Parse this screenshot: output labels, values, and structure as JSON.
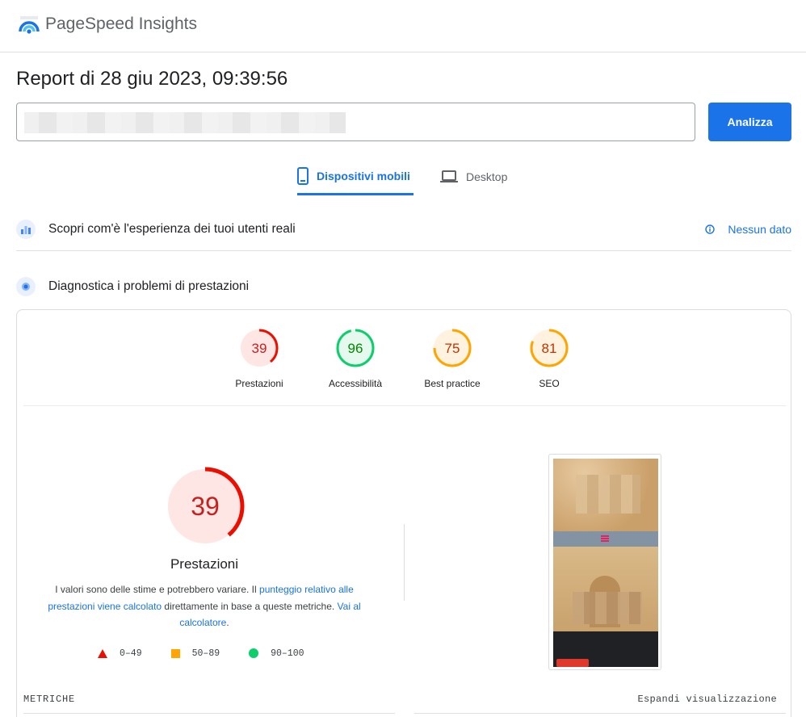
{
  "header": {
    "app_title": "PageSpeed Insights",
    "logo_icon": "pagespeed-logo-icon"
  },
  "report": {
    "title": "Report di 28 giu 2023, 09:39:56"
  },
  "search": {
    "url_value": "",
    "analyze_label": "Analizza"
  },
  "tabs": [
    {
      "label": "Dispositivi mobili",
      "icon": "smartphone-icon",
      "active": true
    },
    {
      "label": "Desktop",
      "icon": "laptop-icon",
      "active": false
    }
  ],
  "field_data": {
    "title": "Scopri com'è l'esperienza dei tuoi utenti reali",
    "no_data_label": "Nessun dato"
  },
  "diagnostics": {
    "title": "Diagnostica i problemi di prestazioni"
  },
  "scores": [
    {
      "label": "Prestazioni",
      "value": "39",
      "color": "#eb0f00"
    },
    {
      "label": "Accessibilità",
      "value": "96",
      "color": "#0cce6b"
    },
    {
      "label": "Best practice",
      "value": "75",
      "color": "#ffa400"
    },
    {
      "label": "SEO",
      "value": "81",
      "color": "#ffa400"
    }
  ],
  "performance": {
    "score": "39",
    "title": "Prestazioni",
    "desc_part1": "I valori sono delle stime e potrebbero variare. Il ",
    "desc_link1": "punteggio relativo alle prestazioni viene calcolato",
    "desc_part2": " direttamente in base a queste metriche. ",
    "desc_link2": "Vai al calcolatore",
    "desc_part3": "."
  },
  "legend": [
    {
      "range": "0–49",
      "shape": "triangle",
      "color": "#eb0f00"
    },
    {
      "range": "50–89",
      "shape": "square",
      "color": "#ffa400"
    },
    {
      "range": "90–100",
      "shape": "circle",
      "color": "#0cce6b"
    }
  ],
  "metrics": {
    "label": "METRICHE",
    "expand_label": "Espandi visualizzazione"
  },
  "colors": {
    "accent": "#1a73e8",
    "fail": "#eb0f00",
    "average": "#ffa400",
    "pass": "#0cce6b"
  }
}
